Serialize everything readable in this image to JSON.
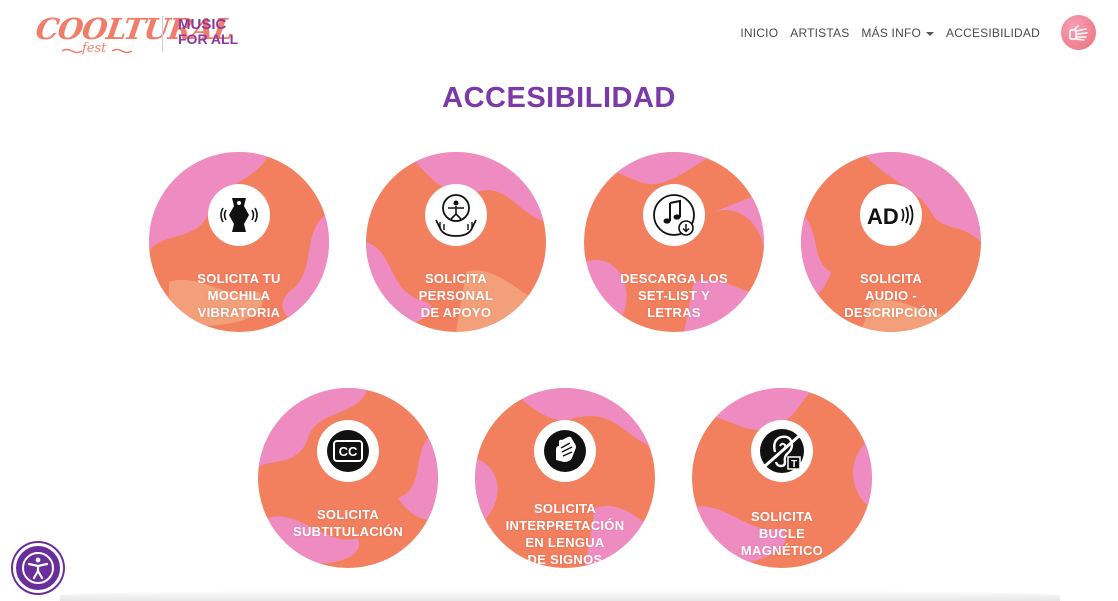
{
  "brand": {
    "logo_word": "COOLTURAL",
    "logo_sub": "fest",
    "music_line1": "MUSIC",
    "music_line2": "FOR ALL"
  },
  "nav": {
    "items": [
      {
        "label": "INICIO"
      },
      {
        "label": "ARTISTAS"
      },
      {
        "label": "MÁS INFO",
        "dropdown": true
      },
      {
        "label": "ACCESIBILIDAD"
      }
    ],
    "hand_icon": "sign-language-hand-icon"
  },
  "page_title": "ACCESIBILIDAD",
  "services": [
    {
      "lines": [
        "SOLICITA TU",
        "MOCHILA",
        "VIBRATORIA"
      ],
      "icon": "vibrating-backpack-icon"
    },
    {
      "lines": [
        "SOLICITA",
        "PERSONAL",
        "DE APOYO"
      ],
      "icon": "support-staff-icon"
    },
    {
      "lines": [
        "DESCARGA LOS",
        "SET-LIST Y",
        "LETRAS"
      ],
      "icon": "music-download-icon"
    },
    {
      "lines": [
        "SOLICITA",
        "AUDIO -",
        "DESCRIPCIÓN"
      ],
      "icon": "audio-description-icon",
      "badge": "AD"
    },
    {
      "lines": [
        "SOLICITA",
        "SUBTITULACIÓN"
      ],
      "icon": "closed-caption-icon",
      "badge": "CC"
    },
    {
      "lines": [
        "SOLICITA",
        "INTERPRETACIÓN",
        "EN LENGUA",
        "DE SIGNOS"
      ],
      "icon": "sign-language-icon"
    },
    {
      "lines": [
        "SOLICITA",
        "BUCLE",
        "MAGNÉTICO"
      ],
      "icon": "hearing-loop-icon",
      "badge": "T"
    }
  ],
  "accessibility_button_icon": "accessibility-person-icon",
  "colors": {
    "accent_purple": "#7b3aa8",
    "circle_orange": "#f07a5a",
    "circle_pink": "#ee8fc0",
    "logo_coral": "#f07c6a"
  }
}
